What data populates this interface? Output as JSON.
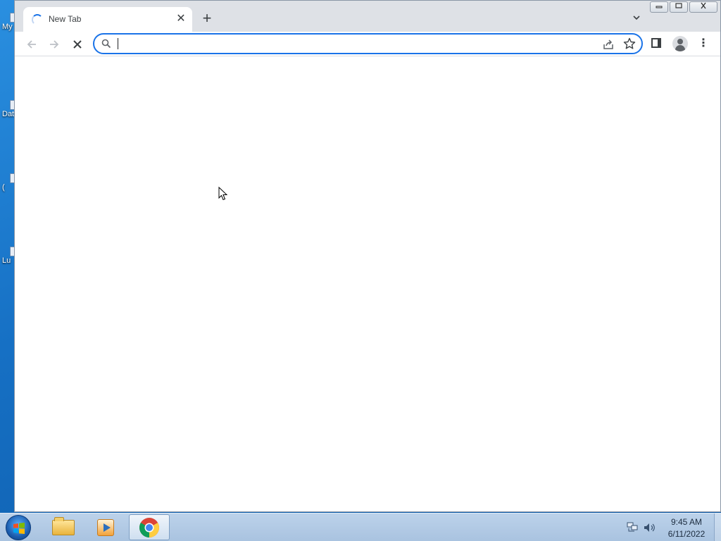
{
  "desktop": {
    "icons": [
      {
        "label": "My"
      },
      {
        "label": "Dat"
      },
      {
        "label": "("
      },
      {
        "label": "Lu"
      }
    ]
  },
  "browser": {
    "tab": {
      "title": "New Tab",
      "close_glyph": "✕"
    },
    "new_tab_glyph": "+",
    "tab_search_glyph": "⌄",
    "window_controls": {
      "minimize": "▭",
      "maximize": "⧉",
      "close": "✕"
    },
    "nav": {
      "back": "←",
      "forward": "→",
      "stop": "✕"
    },
    "omnibox": {
      "value": "",
      "placeholder": ""
    },
    "star_glyph": "☆",
    "menu_glyph": "⋮"
  },
  "taskbar": {
    "apps": [
      {
        "name": "windows-explorer",
        "active": false
      },
      {
        "name": "media-player",
        "active": false
      },
      {
        "name": "google-chrome",
        "active": true
      }
    ],
    "clock": {
      "time": "9:45 AM",
      "date": "6/11/2022"
    }
  },
  "colors": {
    "accent": "#1a73e8",
    "tabstrip": "#dee1e6",
    "desktop": "#1670c4",
    "taskbar": "#b3cae4"
  },
  "icons": [
    "search-icon",
    "share-icon",
    "star-icon",
    "side-panel-icon",
    "profile-icon",
    "menu-icon",
    "loading-spinner-icon",
    "windows-flag-icon",
    "chrome-icon",
    "network-icon",
    "volume-icon"
  ]
}
